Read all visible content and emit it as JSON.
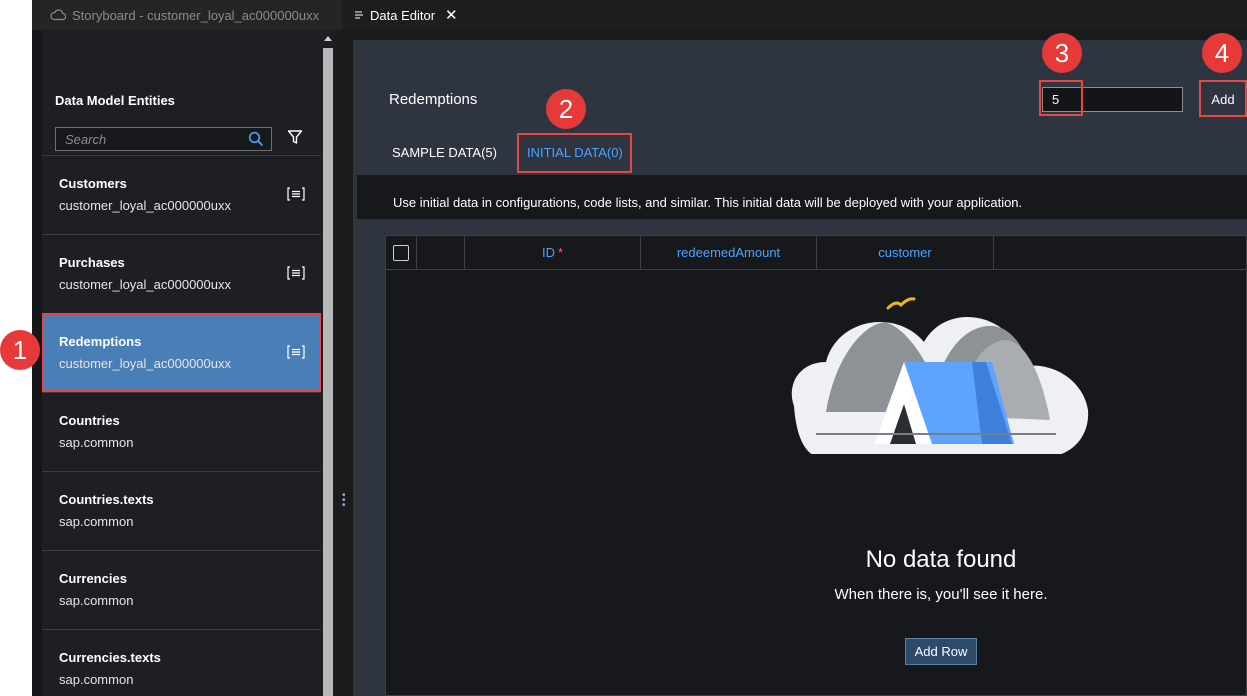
{
  "tabs": [
    {
      "label": "Storyboard - customer_loyal_ac000000uxx",
      "icon": "cloud-icon"
    },
    {
      "label": "Data Editor",
      "icon": "lines-icon",
      "close": "✕"
    }
  ],
  "sidebar": {
    "title": "Data Model Entities",
    "search_placeholder": "Search",
    "items": [
      {
        "name": "Customers",
        "sub": "customer_loyal_ac000000uxx",
        "has_icon": true
      },
      {
        "name": "Purchases",
        "sub": "customer_loyal_ac000000uxx",
        "has_icon": true
      },
      {
        "name": "Redemptions",
        "sub": "customer_loyal_ac000000uxx",
        "has_icon": true,
        "selected": true
      },
      {
        "name": "Countries",
        "sub": "sap.common"
      },
      {
        "name": "Countries.texts",
        "sub": "sap.common"
      },
      {
        "name": "Currencies",
        "sub": "sap.common"
      },
      {
        "name": "Currencies.texts",
        "sub": "sap.common"
      }
    ]
  },
  "main": {
    "title": "Redemptions",
    "count_value": "5",
    "add_label": "Add",
    "tabs": [
      {
        "label": "SAMPLE DATA(5)"
      },
      {
        "label": "INITIAL DATA(0)",
        "active": true
      }
    ],
    "info": "Use initial data in configurations, code lists, and similar. This initial data will be deployed with your application.",
    "columns": [
      {
        "label": "ID",
        "required_mark": "*"
      },
      {
        "label": "redeemedAmount"
      },
      {
        "label": "customer"
      }
    ],
    "empty_title": "No data found",
    "empty_sub": "When there is, you'll see it here.",
    "add_row_label": "Add Row"
  },
  "badges": [
    "1",
    "2",
    "3",
    "4"
  ],
  "colors": {
    "accent": "#4aa3ff",
    "selected": "#4a7eb6",
    "highlight": "#e34848",
    "badge": "#e63a3a"
  }
}
